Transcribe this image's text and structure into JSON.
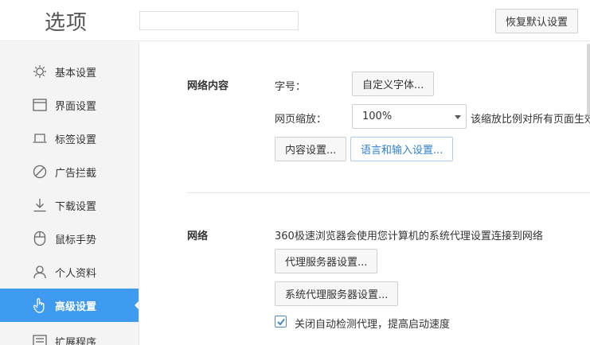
{
  "header": {
    "title": "选项",
    "search_value": "",
    "search_placeholder": "",
    "reset_label": "恢复默认设置"
  },
  "sidebar": {
    "items": [
      {
        "label": "基本设置",
        "icon": "gear-icon"
      },
      {
        "label": "界面设置",
        "icon": "window-icon"
      },
      {
        "label": "标签设置",
        "icon": "tab-icon"
      },
      {
        "label": "广告拦截",
        "icon": "block-icon"
      },
      {
        "label": "下载设置",
        "icon": "download-icon"
      },
      {
        "label": "鼠标手势",
        "icon": "mouse-icon"
      },
      {
        "label": "个人资料",
        "icon": "user-icon"
      },
      {
        "label": "高级设置",
        "icon": "hand-icon",
        "active": true
      },
      {
        "label": "扩展程序",
        "icon": "extension-icon"
      }
    ]
  },
  "web_content": {
    "title": "网络内容",
    "font_size_label": "字号：",
    "custom_font_button": "自定义字体...",
    "zoom_label": "网页缩放：",
    "zoom_value": "100%",
    "zoom_note": "该缩放比例对所有页面生效",
    "content_settings_button": "内容设置...",
    "language_input_button": "语言和输入设置..."
  },
  "network": {
    "title": "网络",
    "description": "360极速浏览器会使用您计算机的系统代理设置连接到网络",
    "proxy_server_button": "代理服务器设置...",
    "system_proxy_button": "系统代理服务器设置...",
    "auto_detect_checked": true,
    "auto_detect_label": "关闭自动检测代理，提高启动速度"
  },
  "colors": {
    "accent": "#3f9bf0",
    "sidebar_bg": "#f4f4f4",
    "link_blue": "#2f7fd1"
  }
}
